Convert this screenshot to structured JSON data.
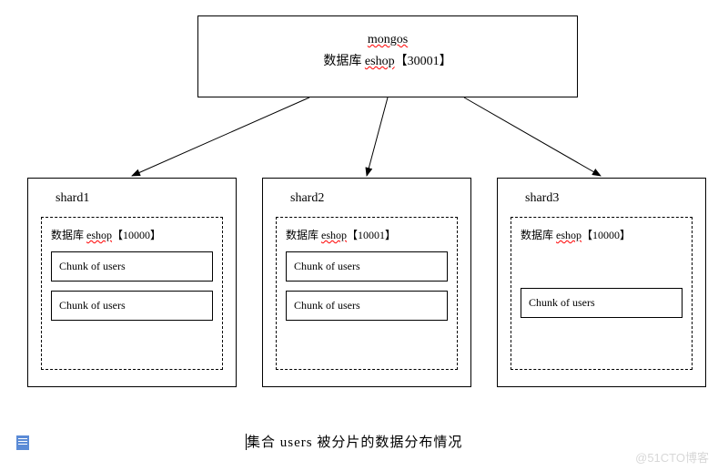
{
  "mongos": {
    "title": "mongos",
    "db_label": "数据库 eshop【30001】"
  },
  "shards": [
    {
      "title": "shard1",
      "db_label": "数据库 eshop【10000】",
      "chunks": [
        "Chunk of users",
        "Chunk of users"
      ]
    },
    {
      "title": "shard2",
      "db_label": "数据库 eshop【10001】",
      "chunks": [
        "Chunk of users",
        "Chunk of users"
      ]
    },
    {
      "title": "shard3",
      "db_label": "数据库 eshop【10000】",
      "chunks": [
        "Chunk of users"
      ]
    }
  ],
  "caption": "集合 users 被分片的数据分布情况",
  "watermark": "@51CTO博客",
  "chart_data": {
    "type": "diagram",
    "description": "MongoDB sharding architecture: a mongos router (database eshop, port 30001) distributes the 'users' collection across three shards.",
    "router": {
      "name": "mongos",
      "database": "eshop",
      "port": 30001
    },
    "shards": [
      {
        "name": "shard1",
        "database": "eshop",
        "port": 10000,
        "chunks_of_users": 2
      },
      {
        "name": "shard2",
        "database": "eshop",
        "port": 10001,
        "chunks_of_users": 2
      },
      {
        "name": "shard3",
        "database": "eshop",
        "port": 10000,
        "chunks_of_users": 1
      }
    ]
  }
}
